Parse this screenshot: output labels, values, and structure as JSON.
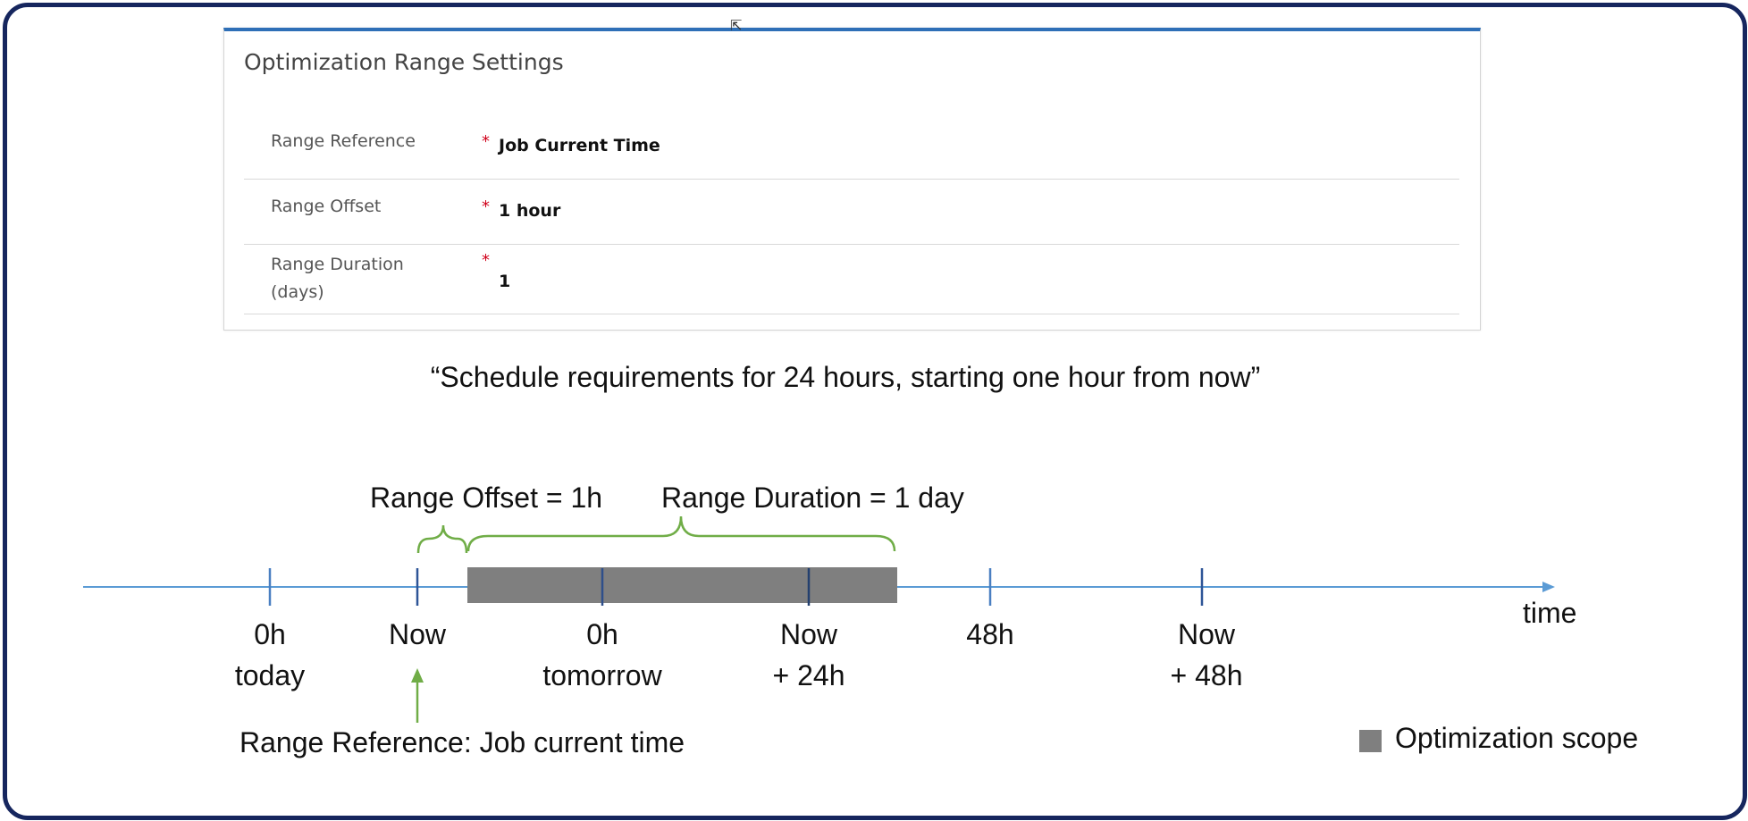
{
  "settings": {
    "title": "Optimization Range Settings",
    "required_marker": "*",
    "rows": [
      {
        "label_line1": "Range Reference",
        "label_line2": "",
        "value": "Job Current Time"
      },
      {
        "label_line1": "Range Offset",
        "label_line2": "",
        "value": "1 hour"
      },
      {
        "label_line1": "Range Duration",
        "label_line2": "(days)",
        "value": "1"
      }
    ]
  },
  "quote": "“Schedule requirements for 24 hours, starting one hour from now”",
  "timeline": {
    "offset_label": "Range Offset = 1h",
    "duration_label": "Range Duration = 1 day",
    "axis_label": "time",
    "ticks": [
      {
        "line1": "0h",
        "line2": "today"
      },
      {
        "line1": "Now",
        "line2": ""
      },
      {
        "line1": "0h",
        "line2": "tomorrow"
      },
      {
        "line1": "Now",
        "line2": "+ 24h"
      },
      {
        "line1": "48h",
        "line2": ""
      },
      {
        "line1": "Now",
        "line2": "+ 48h"
      }
    ],
    "reference_label": "Range Reference: Job current time",
    "legend_label": "Optimization scope"
  },
  "colors": {
    "frame": "#16265e",
    "panel_accent": "#2e6fb7",
    "axis": "#5b9bd5",
    "tick": "#2e5597",
    "scope": "#7f7f7f",
    "bracket": "#70ad47",
    "required": "#d0021b"
  }
}
